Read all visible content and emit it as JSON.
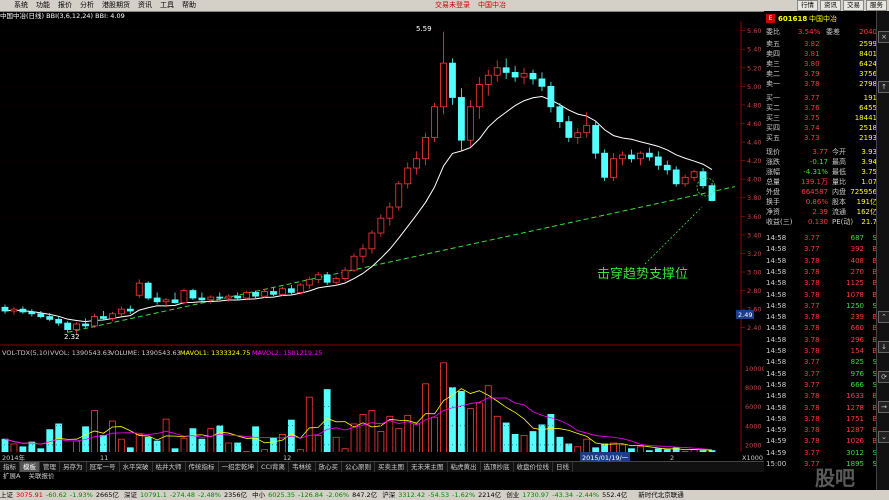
{
  "menu": {
    "items": [
      "系统",
      "功能",
      "报价",
      "分析",
      "港股期货",
      "资讯",
      "工具",
      "帮助"
    ],
    "center_left": "交易未登录",
    "center_right": "中国中冶",
    "window_buttons": [
      "行情",
      "资讯",
      "交易",
      "服务"
    ]
  },
  "chart_header": {
    "stock": "中国中冶(日线)",
    "indicator": "BBI(3,6,12,24)",
    "bbi_label": "BBI:",
    "bbi_value": "4.09"
  },
  "price_axis": {
    "ticks": [
      "5.60",
      "5.40",
      "5.20",
      "5.00",
      "4.80",
      "4.60",
      "4.40",
      "4.20",
      "4.00",
      "3.80",
      "3.60",
      "3.40",
      "3.20",
      "3.00",
      "2.80",
      "2.60",
      "2.40"
    ],
    "current_marker": "2.49",
    "high_label": "5.59",
    "low_label": "2.32"
  },
  "annotation": {
    "text": "击穿趋势支撑位",
    "color": "#3adf3a"
  },
  "volume_header": {
    "indicator": "VOL-TDX(5,10)",
    "vvol": "VVOL: 1390543.63",
    "volume": "VOLUME: 1390543.63",
    "mavol1": "MAVOL1: 1333324.75",
    "mavol2": "MAVOL2: 1501219.25"
  },
  "volume_axis": {
    "ticks": [
      "10000",
      "8000",
      "6000",
      "4000",
      "2000"
    ],
    "unit": "X1000"
  },
  "date_axis": {
    "year_label": "2014年",
    "month_11": "11",
    "month_12": "12",
    "cursor_date": "2015/01/19/一",
    "month_2": "2"
  },
  "chart_data": {
    "type": "candlestick",
    "title": "中国中冶(日线)",
    "ylim": [
      2.3,
      5.65
    ],
    "volume_ylim": [
      0,
      11000
    ],
    "candles": [
      {
        "o": 2.62,
        "h": 2.65,
        "l": 2.55,
        "c": 2.58
      },
      {
        "o": 2.58,
        "h": 2.62,
        "l": 2.54,
        "c": 2.6
      },
      {
        "o": 2.6,
        "h": 2.63,
        "l": 2.55,
        "c": 2.57
      },
      {
        "o": 2.57,
        "h": 2.6,
        "l": 2.52,
        "c": 2.55
      },
      {
        "o": 2.55,
        "h": 2.58,
        "l": 2.5,
        "c": 2.52
      },
      {
        "o": 2.52,
        "h": 2.56,
        "l": 2.47,
        "c": 2.49
      },
      {
        "o": 2.49,
        "h": 2.52,
        "l": 2.42,
        "c": 2.45
      },
      {
        "o": 2.45,
        "h": 2.47,
        "l": 2.35,
        "c": 2.38
      },
      {
        "o": 2.38,
        "h": 2.46,
        "l": 2.32,
        "c": 2.44
      },
      {
        "o": 2.44,
        "h": 2.5,
        "l": 2.4,
        "c": 2.42
      },
      {
        "o": 2.42,
        "h": 2.55,
        "l": 2.4,
        "c": 2.52
      },
      {
        "o": 2.52,
        "h": 2.58,
        "l": 2.48,
        "c": 2.5
      },
      {
        "o": 2.5,
        "h": 2.57,
        "l": 2.47,
        "c": 2.55
      },
      {
        "o": 2.55,
        "h": 2.63,
        "l": 2.52,
        "c": 2.6
      },
      {
        "o": 2.6,
        "h": 2.64,
        "l": 2.55,
        "c": 2.58
      },
      {
        "o": 2.75,
        "h": 2.92,
        "l": 2.72,
        "c": 2.88
      },
      {
        "o": 2.88,
        "h": 2.9,
        "l": 2.7,
        "c": 2.72
      },
      {
        "o": 2.72,
        "h": 2.78,
        "l": 2.65,
        "c": 2.68
      },
      {
        "o": 2.68,
        "h": 2.72,
        "l": 2.62,
        "c": 2.7
      },
      {
        "o": 2.7,
        "h": 2.78,
        "l": 2.66,
        "c": 2.67
      },
      {
        "o": 2.67,
        "h": 2.82,
        "l": 2.65,
        "c": 2.8
      },
      {
        "o": 2.8,
        "h": 2.82,
        "l": 2.7,
        "c": 2.72
      },
      {
        "o": 2.72,
        "h": 2.78,
        "l": 2.68,
        "c": 2.7
      },
      {
        "o": 2.7,
        "h": 2.75,
        "l": 2.66,
        "c": 2.73
      },
      {
        "o": 2.73,
        "h": 2.78,
        "l": 2.7,
        "c": 2.72
      },
      {
        "o": 2.72,
        "h": 2.76,
        "l": 2.68,
        "c": 2.74
      },
      {
        "o": 2.74,
        "h": 2.78,
        "l": 2.7,
        "c": 2.72
      },
      {
        "o": 2.72,
        "h": 2.8,
        "l": 2.7,
        "c": 2.78
      },
      {
        "o": 2.78,
        "h": 2.8,
        "l": 2.72,
        "c": 2.74
      },
      {
        "o": 2.74,
        "h": 2.82,
        "l": 2.72,
        "c": 2.79
      },
      {
        "o": 2.79,
        "h": 2.83,
        "l": 2.74,
        "c": 2.76
      },
      {
        "o": 2.76,
        "h": 2.84,
        "l": 2.74,
        "c": 2.82
      },
      {
        "o": 2.82,
        "h": 2.86,
        "l": 2.76,
        "c": 2.78
      },
      {
        "o": 2.78,
        "h": 2.88,
        "l": 2.76,
        "c": 2.86
      },
      {
        "o": 2.86,
        "h": 2.95,
        "l": 2.82,
        "c": 2.92
      },
      {
        "o": 2.92,
        "h": 3.0,
        "l": 2.88,
        "c": 2.97
      },
      {
        "o": 2.97,
        "h": 3.0,
        "l": 2.86,
        "c": 2.89
      },
      {
        "o": 2.89,
        "h": 2.95,
        "l": 2.85,
        "c": 2.93
      },
      {
        "o": 2.93,
        "h": 3.05,
        "l": 2.9,
        "c": 3.02
      },
      {
        "o": 3.02,
        "h": 3.2,
        "l": 3.0,
        "c": 3.17
      },
      {
        "o": 3.17,
        "h": 3.3,
        "l": 3.1,
        "c": 3.25
      },
      {
        "o": 3.25,
        "h": 3.45,
        "l": 3.2,
        "c": 3.42
      },
      {
        "o": 3.42,
        "h": 3.62,
        "l": 3.38,
        "c": 3.58
      },
      {
        "o": 3.58,
        "h": 3.75,
        "l": 3.5,
        "c": 3.7
      },
      {
        "o": 3.7,
        "h": 3.98,
        "l": 3.66,
        "c": 3.95
      },
      {
        "o": 3.95,
        "h": 4.18,
        "l": 3.9,
        "c": 4.12
      },
      {
        "o": 4.12,
        "h": 4.3,
        "l": 4.05,
        "c": 4.22
      },
      {
        "o": 4.22,
        "h": 4.5,
        "l": 4.15,
        "c": 4.45
      },
      {
        "o": 4.45,
        "h": 4.82,
        "l": 4.4,
        "c": 4.78
      },
      {
        "o": 4.78,
        "h": 5.59,
        "l": 4.7,
        "c": 5.25
      },
      {
        "o": 5.25,
        "h": 5.3,
        "l": 4.8,
        "c": 4.88
      },
      {
        "o": 4.88,
        "h": 4.98,
        "l": 4.3,
        "c": 4.42
      },
      {
        "o": 4.42,
        "h": 4.85,
        "l": 4.35,
        "c": 4.78
      },
      {
        "o": 4.78,
        "h": 5.1,
        "l": 4.65,
        "c": 5.02
      },
      {
        "o": 5.02,
        "h": 5.18,
        "l": 4.9,
        "c": 5.12
      },
      {
        "o": 5.12,
        "h": 5.28,
        "l": 5.05,
        "c": 5.2
      },
      {
        "o": 5.2,
        "h": 5.3,
        "l": 5.08,
        "c": 5.15
      },
      {
        "o": 5.15,
        "h": 5.22,
        "l": 5.05,
        "c": 5.1
      },
      {
        "o": 5.1,
        "h": 5.2,
        "l": 5.02,
        "c": 5.14
      },
      {
        "o": 5.14,
        "h": 5.18,
        "l": 5.02,
        "c": 5.08
      },
      {
        "o": 5.08,
        "h": 5.15,
        "l": 4.95,
        "c": 5.0
      },
      {
        "o": 5.0,
        "h": 5.05,
        "l": 4.72,
        "c": 4.78
      },
      {
        "o": 4.78,
        "h": 4.82,
        "l": 4.55,
        "c": 4.62
      },
      {
        "o": 4.62,
        "h": 4.68,
        "l": 4.4,
        "c": 4.45
      },
      {
        "o": 4.45,
        "h": 4.55,
        "l": 4.38,
        "c": 4.5
      },
      {
        "o": 4.5,
        "h": 4.72,
        "l": 4.45,
        "c": 4.58
      },
      {
        "o": 4.58,
        "h": 4.62,
        "l": 4.22,
        "c": 4.28
      },
      {
        "o": 4.28,
        "h": 4.32,
        "l": 3.98,
        "c": 4.02
      },
      {
        "o": 4.02,
        "h": 4.28,
        "l": 3.98,
        "c": 4.22
      },
      {
        "o": 4.22,
        "h": 4.3,
        "l": 4.15,
        "c": 4.26
      },
      {
        "o": 4.26,
        "h": 4.32,
        "l": 4.18,
        "c": 4.22
      },
      {
        "o": 4.22,
        "h": 4.3,
        "l": 4.15,
        "c": 4.28
      },
      {
        "o": 4.28,
        "h": 4.34,
        "l": 4.2,
        "c": 4.24
      },
      {
        "o": 4.24,
        "h": 4.3,
        "l": 4.1,
        "c": 4.15
      },
      {
        "o": 4.15,
        "h": 4.2,
        "l": 4.05,
        "c": 4.1
      },
      {
        "o": 4.1,
        "h": 4.14,
        "l": 3.92,
        "c": 3.95
      },
      {
        "o": 3.95,
        "h": 4.05,
        "l": 3.92,
        "c": 4.02
      },
      {
        "o": 4.02,
        "h": 4.1,
        "l": 3.98,
        "c": 4.08
      },
      {
        "o": 4.08,
        "h": 4.12,
        "l": 3.9,
        "c": 3.93
      },
      {
        "o": 3.93,
        "h": 3.96,
        "l": 3.76,
        "c": 3.77
      }
    ],
    "volumes": [
      2600,
      2100,
      1800,
      2300,
      1600,
      3600,
      4200,
      1200,
      2400,
      3900,
      5600,
      3000,
      4500,
      2600,
      1700,
      3100,
      2800,
      2400,
      4700,
      1600,
      2700,
      3700,
      2600,
      3700,
      4000,
      2200,
      2200,
      1300,
      3900,
      1500,
      2700,
      3100,
      4600,
      1500,
      7000,
      3000,
      7800,
      2800,
      1600,
      4200,
      5200,
      5600,
      3400,
      5000,
      3700,
      5100,
      4200,
      8400,
      4900,
      10600,
      8000,
      7600,
      5800,
      6400,
      8200,
      5000,
      4300,
      3100,
      3000,
      3400,
      4100,
      5200,
      2800,
      2100,
      1800,
      2600,
      1700,
      2100,
      2200,
      2000,
      1600,
      1800,
      1400,
      1600,
      1500,
      1700,
      1300,
      1500,
      1400,
      1400
    ],
    "support_line": {
      "from_price": 2.35,
      "to_price": 3.92
    }
  },
  "quote_panel": {
    "code": "601618",
    "name": "中国中冶",
    "weibi_label": "委比",
    "weibi_value": "3.54%",
    "weicha_label": "委差",
    "weicha_value": "2040",
    "sells": [
      {
        "label": "卖五",
        "price": "3.82",
        "vol": "2599"
      },
      {
        "label": "卖四",
        "price": "3.81",
        "vol": "8401"
      },
      {
        "label": "卖三",
        "price": "3.80",
        "vol": "6424"
      },
      {
        "label": "卖二",
        "price": "3.79",
        "vol": "3756"
      },
      {
        "label": "卖一",
        "price": "3.78",
        "vol": "2798"
      }
    ],
    "buys": [
      {
        "label": "买一",
        "price": "3.77",
        "vol": "191"
      },
      {
        "label": "买二",
        "price": "3.76",
        "vol": "6455"
      },
      {
        "label": "买三",
        "price": "3.75",
        "vol": "18441"
      },
      {
        "label": "买四",
        "price": "3.74",
        "vol": "2518"
      },
      {
        "label": "买五",
        "price": "3.73",
        "vol": "2193"
      }
    ],
    "stats": [
      {
        "l1": "现价",
        "v1": "3.77",
        "l2": "今开",
        "v2": "3.93"
      },
      {
        "l1": "涨跌",
        "v1": "-0.17",
        "l2": "最高",
        "v2": "3.94"
      },
      {
        "l1": "涨幅",
        "v1": "-4.31%",
        "l2": "最低",
        "v2": "3.75"
      },
      {
        "l1": "总量",
        "v1": "139.1万",
        "l2": "量比",
        "v2": "1.07"
      },
      {
        "l1": "外盘",
        "v1": "664587",
        "l2": "内盘",
        "v2": "725956"
      },
      {
        "l1": "换手",
        "v1": "0.86%",
        "l2": "股本",
        "v2": "191亿"
      },
      {
        "l1": "净资",
        "v1": "2.39",
        "l2": "流通",
        "v2": "162亿"
      },
      {
        "l1": "收益(三)",
        "v1": "0.130",
        "l2": "PE(动)",
        "v2": "21.7"
      }
    ],
    "ticks": [
      {
        "t": "14:58",
        "p": "3.77",
        "v": "687",
        "s": "S"
      },
      {
        "t": "14:58",
        "p": "3.77",
        "v": "392",
        "s": "B"
      },
      {
        "t": "14:58",
        "p": "3.78",
        "v": "408",
        "s": "B"
      },
      {
        "t": "14:58",
        "p": "3.78",
        "v": "270",
        "s": "B"
      },
      {
        "t": "14:58",
        "p": "3.78",
        "v": "1125",
        "s": "B"
      },
      {
        "t": "14:58",
        "p": "3.78",
        "v": "1078",
        "s": "B"
      },
      {
        "t": "14:58",
        "p": "3.77",
        "v": "1250",
        "s": "S"
      },
      {
        "t": "14:58",
        "p": "3.78",
        "v": "239",
        "s": "B"
      },
      {
        "t": "14:58",
        "p": "3.78",
        "v": "660",
        "s": "B"
      },
      {
        "t": "14:58",
        "p": "3.78",
        "v": "296",
        "s": "B"
      },
      {
        "t": "14:58",
        "p": "3.78",
        "v": "154",
        "s": "B"
      },
      {
        "t": "14:58",
        "p": "3.77",
        "v": "825",
        "s": "S"
      },
      {
        "t": "14:58",
        "p": "3.77",
        "v": "976",
        "s": "S"
      },
      {
        "t": "14:58",
        "p": "3.77",
        "v": "666",
        "s": "S"
      },
      {
        "t": "14:58",
        "p": "3.78",
        "v": "1633",
        "s": "B"
      },
      {
        "t": "14:58",
        "p": "3.78",
        "v": "1278",
        "s": "B"
      },
      {
        "t": "14:58",
        "p": "3.78",
        "v": "1751",
        "s": "B"
      },
      {
        "t": "14:59",
        "p": "3.78",
        "v": "1287",
        "s": "B"
      },
      {
        "t": "14:59",
        "p": "3.78",
        "v": "1026",
        "s": "B"
      },
      {
        "t": "14:59",
        "p": "3.77",
        "v": "3012",
        "s": "S"
      },
      {
        "t": "15:00",
        "p": "3.77",
        "v": "1895",
        "s": "S"
      }
    ]
  },
  "bottom_tabs": [
    "指标",
    "模板",
    "管理",
    "另存为",
    "冠军一号",
    "水平突破",
    "枯井大师",
    "传统指标",
    "一招定乾坤",
    "CCI背离",
    "韦林统",
    "放心买",
    "公心原则",
    "买卖主图",
    "无未来主图",
    "粘虎黄出",
    "选顶抄底",
    "收盘价位线",
    "日线"
  ],
  "sub_tabs": [
    "扩展A",
    "关联报价"
  ],
  "status_bar": {
    "sh_label": "上证",
    "sh_val": "3075.91",
    "sh_chg": "-60.62",
    "sh_pct": "-1.93%",
    "sh_amt": "2665亿",
    "sz_label": "深证",
    "sz_val": "10791.1",
    "sz_chg": "-274.48",
    "sz_pct": "-2.48%",
    "sz_amt": "2356亿",
    "zx_label": "中小",
    "zx_val": "6025.35",
    "zx_chg": "-126.84",
    "zx_pct": "-2.06%",
    "zx_amt": "847.2亿",
    "hs_label": "沪深",
    "hs_val": "3312.42",
    "hs_chg": "-54.53",
    "hs_pct": "-1.62%",
    "hs_amt": "2214亿",
    "cy_label": "创业",
    "cy_val": "1730.97",
    "cy_chg": "-43.34",
    "cy_pct": "-2.44%",
    "cy_amt": "552.4亿",
    "broker": "新时代北京联通"
  },
  "watermark": "股吧"
}
